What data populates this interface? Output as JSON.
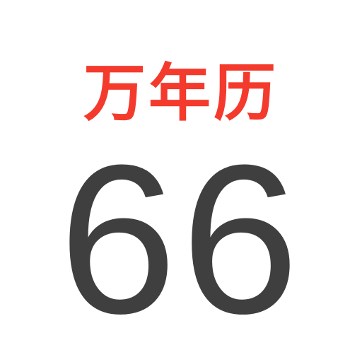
{
  "app": {
    "title": "万年历",
    "day_number": "66"
  },
  "colors": {
    "title_red": "#f43a2c",
    "number_dark": "#3f3f3f",
    "background": "#ffffff"
  }
}
